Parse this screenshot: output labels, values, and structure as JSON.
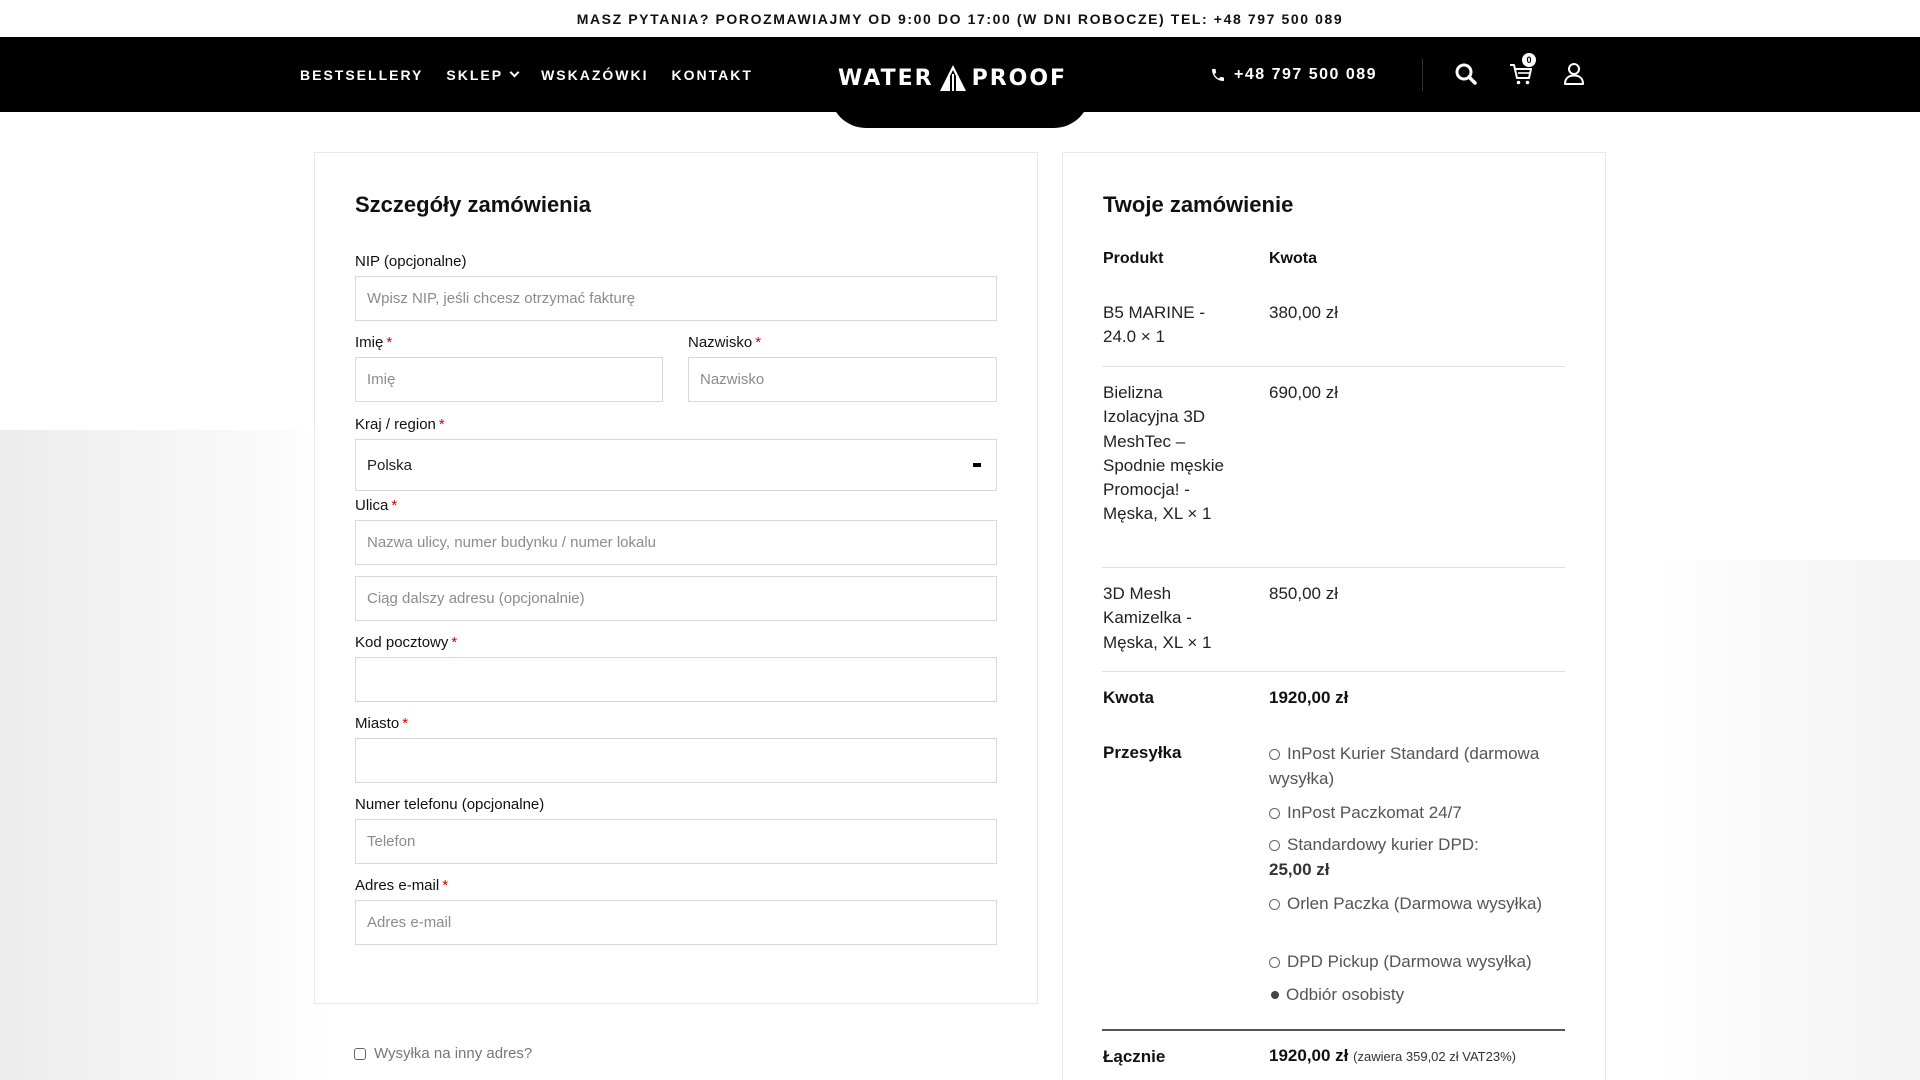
{
  "topbar": {
    "text": "MASZ PYTANIA? POROZMAWIAJMY OD 9:00 DO 17:00 (W DNI ROBOCZE) TEL: +48 797 500 089"
  },
  "header": {
    "nav": [
      {
        "label": "BESTSELLERY"
      },
      {
        "label": "SKLEP"
      },
      {
        "label": "WSKAZÓWKI"
      },
      {
        "label": "KONTAKT"
      }
    ],
    "logo_left": "WATER",
    "logo_right": "PROOF",
    "phone": "+48 797 500 089",
    "cart_count": "0",
    "icons": [
      "phone-icon",
      "search-icon",
      "cart-icon",
      "user-icon"
    ]
  },
  "form": {
    "title": "Szczegóły zamówienia",
    "nip": {
      "label": "NIP (opcjonalne)",
      "placeholder": "Wpisz NIP, jeśli chcesz otrzymać fakturę"
    },
    "first_name": {
      "label": "Imię",
      "placeholder": "Imię"
    },
    "last_name": {
      "label": "Nazwisko",
      "placeholder": "Nazwisko"
    },
    "country": {
      "label": "Kraj / region",
      "value": "Polska"
    },
    "street": {
      "label": "Ulica",
      "placeholder": "Nazwa ulicy, numer budynku / numer lokalu"
    },
    "street2": {
      "placeholder": "Ciąg dalszy adresu (opcjonalnie)"
    },
    "postcode": {
      "label": "Kod pocztowy",
      "placeholder": ""
    },
    "city": {
      "label": "Miasto",
      "placeholder": ""
    },
    "phone": {
      "label": "Numer telefonu (opcjonalne)",
      "placeholder": "Telefon"
    },
    "email": {
      "label": "Adres e-mail",
      "placeholder": "Adres e-mail"
    },
    "required_mark": "*",
    "ship_other": "Wysyłka na inny adres?"
  },
  "order": {
    "title": "Twoje zamówienie",
    "col_product": "Produkt",
    "col_amount": "Kwota",
    "items": [
      {
        "name": "B5 MARINE - 24.0  × 1",
        "price": "380,00 zł"
      },
      {
        "name": "Bielizna Izolacyjna 3D MeshTec – Spodnie męskie Promocja! - Męska, XL  × 1",
        "price": "690,00 zł"
      },
      {
        "name": "3D Mesh Kamizelka - Męska, XL  × 1",
        "price": "850,00 zł"
      }
    ],
    "subtotal_label": "Kwota",
    "subtotal": "1920,00 zł",
    "shipping_label": "Przesyłka",
    "shipping_options": [
      {
        "label": "InPost Kurier Standard (darmowa wysyłka)",
        "price": "",
        "selected": false
      },
      {
        "label": "InPost Paczkomat 24/7",
        "price": "",
        "selected": false
      },
      {
        "label": "Standardowy kurier DPD:",
        "price": "25,00 zł",
        "selected": false
      },
      {
        "label": "Orlen Paczka (Darmowa wysyłka)",
        "price": "",
        "selected": false
      },
      {
        "label": "DPD Pickup (Darmowa wysyłka)",
        "price": "",
        "selected": false
      },
      {
        "label": "Odbiór osobisty",
        "price": "",
        "selected": true
      }
    ],
    "total_label": "Łącznie",
    "total": "1920,00 zł",
    "total_note": "(zawiera 359,02 zł VAT23%)"
  }
}
